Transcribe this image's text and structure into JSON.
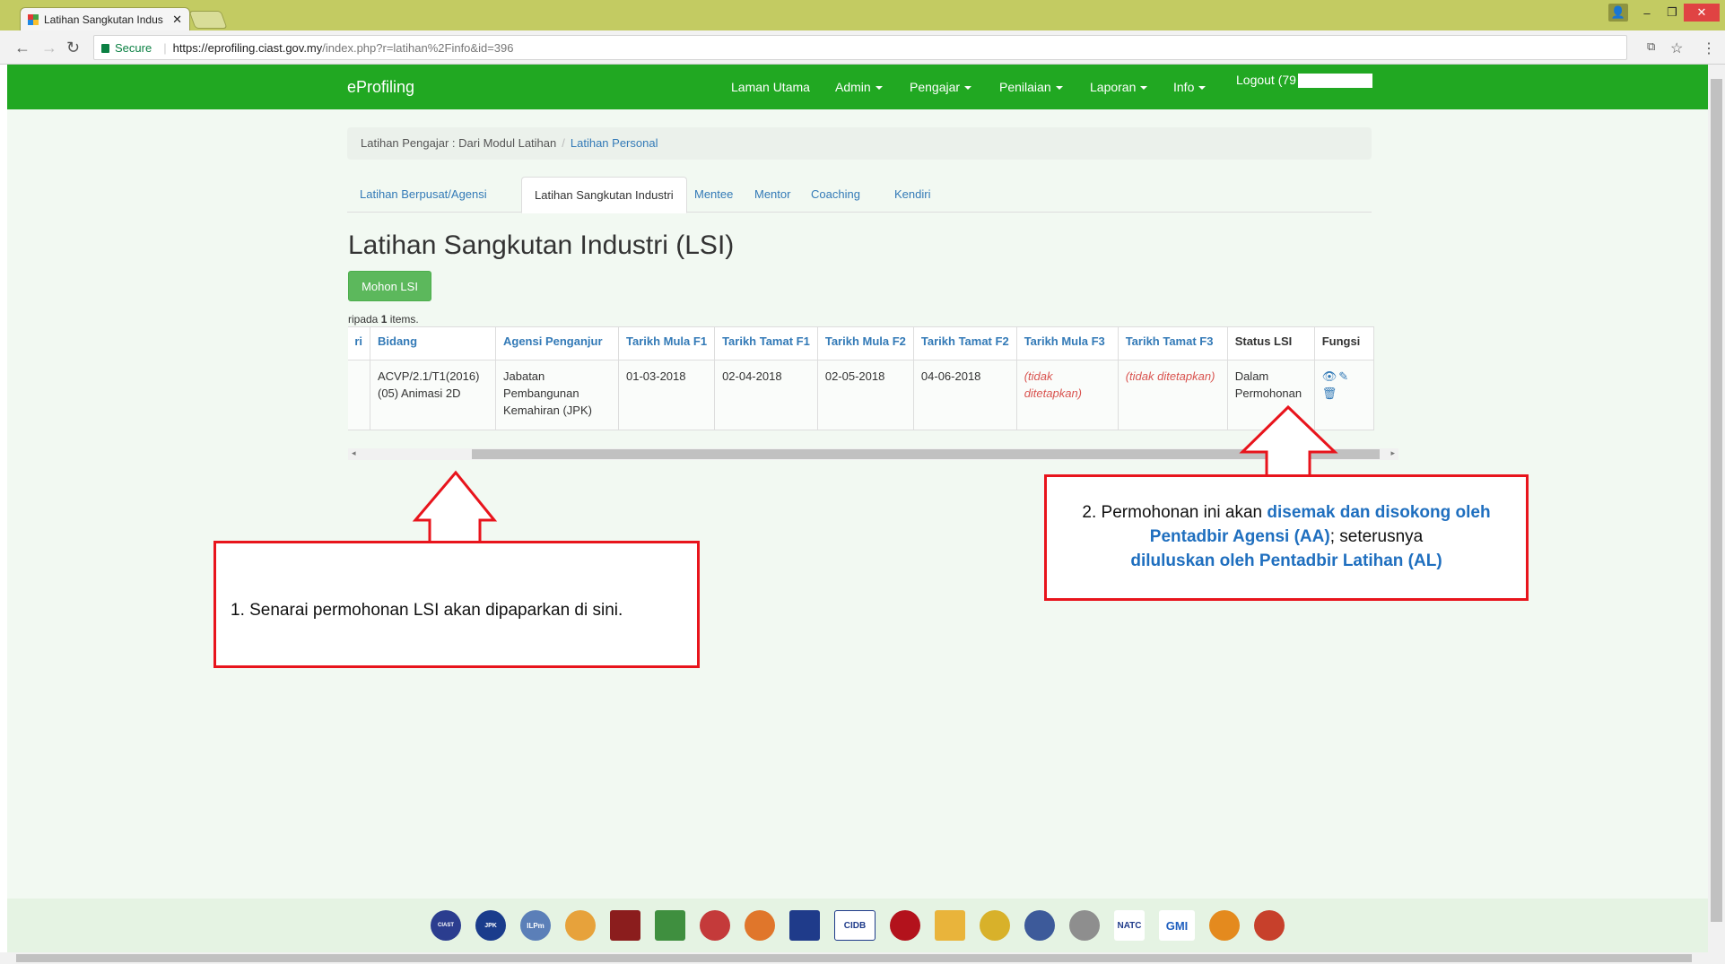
{
  "browser": {
    "tab_title": "Latihan Sangkutan Indus",
    "secure_label": "Secure",
    "url_host": "https://eprofiling.ciast.gov.my",
    "url_path": "/index.php?r=latihan%2Finfo&id=396"
  },
  "navbar": {
    "brand": "eProfiling",
    "items": [
      "Laman Utama",
      "Admin",
      "Pengajar",
      "Penilaian",
      "Laporan",
      "Info"
    ],
    "logout": "Logout (79"
  },
  "breadcrumb": {
    "first": "Latihan Pengajar : Dari Modul Latihan",
    "second": "Latihan Personal"
  },
  "tabs": [
    "Latihan Berpusat/Agensi",
    "Latihan Sangkutan Industri",
    "Mentee",
    "Mentor",
    "Coaching",
    "Kendiri"
  ],
  "page_title": "Latihan Sangkutan Industri (LSI)",
  "apply_button": "Mohon LSI",
  "summary": {
    "prefix": "ripada ",
    "count": "1",
    "suffix": " items."
  },
  "table": {
    "headers": [
      "ri",
      "Bidang",
      "Agensi Penganjur",
      "Tarikh Mula F1",
      "Tarikh Tamat F1",
      "Tarikh Mula F2",
      "Tarikh Tamat F2",
      "Tarikh Mula F3",
      "Tarikh Tamat F3",
      "Status LSI",
      "Fungsi"
    ],
    "row": {
      "bidang": "ACVP/2.1/T1(2016) (05) Animasi 2D",
      "agensi": "Jabatan Pembangunan Kemahiran (JPK)",
      "mula_f1": "01-03-2018",
      "tamat_f1": "02-04-2018",
      "mula_f2": "02-05-2018",
      "tamat_f2": "04-06-2018",
      "mula_f3": "(tidak ditetapkan)",
      "tamat_f3": "(tidak ditetapkan)",
      "status": "Dalam Permohonan"
    }
  },
  "callouts": {
    "one": "1. Senarai permohonan LSI akan dipaparkan di sini.",
    "two_a": "2. Permohonan ini akan ",
    "two_b": "disemak dan disokong oleh Pentadbir Agensi (AA)",
    "two_c": "; seterusnya",
    "two_d": "diluluskan oleh Pentadbir Latihan (AL)"
  },
  "footer_logos": [
    "CIAST",
    "JPK",
    "ILPm",
    "",
    "",
    "",
    "",
    "",
    "",
    "CIDB",
    "",
    "",
    "",
    "",
    "",
    "NATC",
    "GMI",
    "",
    ""
  ]
}
